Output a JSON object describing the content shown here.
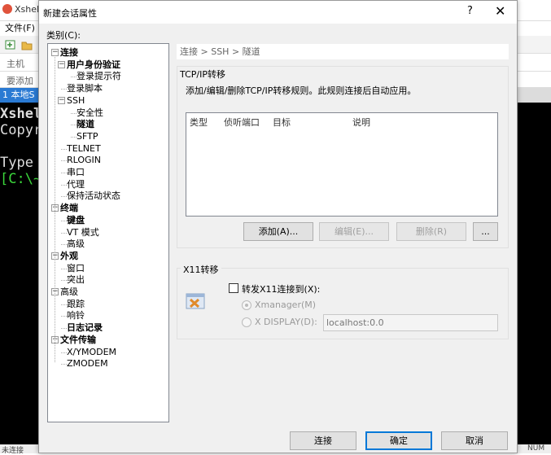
{
  "app": {
    "title": "Xshell",
    "menu_file": "文件(F)",
    "address_label": "主机",
    "tip_label": "要添加",
    "tab_label": "1 本地S",
    "terminal_lines": [
      "Xshel",
      "Copyr",
      "",
      "Type",
      "[C:\\~"
    ],
    "status_left": "未连接",
    "status_right": "NUM"
  },
  "dialog": {
    "title": "新建会话属性",
    "help": "?",
    "close": "✕",
    "category_label": "类别(C):",
    "tree": [
      {
        "label": "连接",
        "level": 0,
        "bold": true,
        "toggle": "−"
      },
      {
        "label": "用户身份验证",
        "level": 1,
        "bold": true,
        "toggle": "−"
      },
      {
        "label": "登录提示符",
        "level": 2,
        "bold": false
      },
      {
        "label": "登录脚本",
        "level": 1,
        "bold": false
      },
      {
        "label": "SSH",
        "level": 1,
        "bold": false,
        "toggle": "−"
      },
      {
        "label": "安全性",
        "level": 2,
        "bold": false
      },
      {
        "label": "隧道",
        "level": 2,
        "bold": true
      },
      {
        "label": "SFTP",
        "level": 2,
        "bold": false
      },
      {
        "label": "TELNET",
        "level": 1,
        "bold": false
      },
      {
        "label": "RLOGIN",
        "level": 1,
        "bold": false
      },
      {
        "label": "串口",
        "level": 1,
        "bold": false
      },
      {
        "label": "代理",
        "level": 1,
        "bold": false
      },
      {
        "label": "保持活动状态",
        "level": 1,
        "bold": false
      },
      {
        "label": "终端",
        "level": 0,
        "bold": true,
        "toggle": "−"
      },
      {
        "label": "键盘",
        "level": 1,
        "bold": true
      },
      {
        "label": "VT 模式",
        "level": 1,
        "bold": false
      },
      {
        "label": "高级",
        "level": 1,
        "bold": false
      },
      {
        "label": "外观",
        "level": 0,
        "bold": true,
        "toggle": "−"
      },
      {
        "label": "窗口",
        "level": 1,
        "bold": false
      },
      {
        "label": "突出",
        "level": 1,
        "bold": false
      },
      {
        "label": "高级",
        "level": 0,
        "bold": false,
        "toggle": "−"
      },
      {
        "label": "跟踪",
        "level": 1,
        "bold": false
      },
      {
        "label": "响铃",
        "level": 1,
        "bold": false
      },
      {
        "label": "日志记录",
        "level": 1,
        "bold": true
      },
      {
        "label": "文件传输",
        "level": 0,
        "bold": true,
        "toggle": "−"
      },
      {
        "label": "X/YMODEM",
        "level": 1,
        "bold": false
      },
      {
        "label": "ZMODEM",
        "level": 1,
        "bold": false
      }
    ],
    "breadcrumb": "连接 > SSH > 隧道",
    "tcp": {
      "title": "TCP/IP转移",
      "description": "添加/编辑/删除TCP/IP转移规则。此规则连接后自动应用。",
      "columns": [
        "类型",
        "侦听端口",
        "目标",
        "说明"
      ],
      "add": "添加(A)...",
      "edit": "编辑(E)...",
      "delete": "删除(R)",
      "more": "..."
    },
    "x11": {
      "title": "X11转移",
      "forward": "转发X11连接到(X):",
      "xmanager": "Xmanager(M)",
      "xdisplay": "X DISPLAY(D):",
      "xdisplay_value": "localhost:0.0"
    },
    "connect": "连接",
    "ok": "确定",
    "cancel": "取消"
  }
}
